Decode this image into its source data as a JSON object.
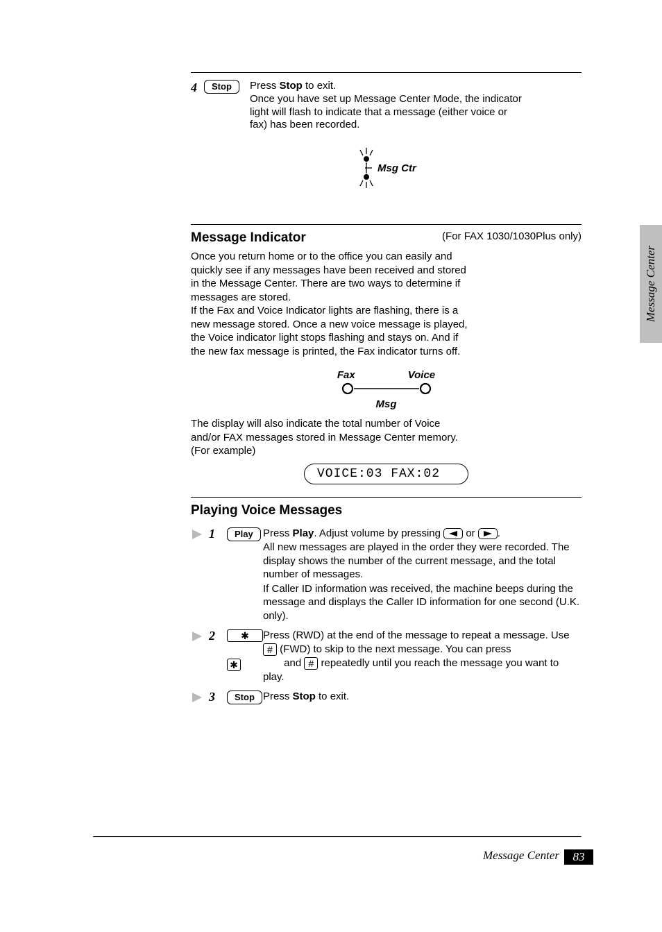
{
  "sidetab": {
    "text": "Message Center"
  },
  "b1": {
    "step_num": "4",
    "key_label": "Stop",
    "text_lines": [
      "Press Stop to exit.",
      "Once you have set up Message Center Mode, the indicator",
      "light will flash to indicate that a message (either voice or",
      "fax) has been recorded."
    ],
    "indicator_label": "Msg Ctr"
  },
  "b2": {
    "heading": "Message Indicator",
    "model": "(For FAX 1030/1030Plus only)",
    "body_lines": [
      "Once you return home or to the office you can easily and",
      "quickly see if any messages have been received and stored",
      "in the Message Center. There are two ways to determine if",
      "messages are stored.",
      "If the Fax and Voice Indicator lights are flashing, there is a",
      "new message stored. Once a new voice message is played,",
      "the Voice indicator light stops flashing and stays on. And if",
      "the new fax message is printed, the Fax indicator turns off."
    ],
    "ind2": {
      "label_fax": "Fax",
      "label_voice": "Voice",
      "sub": "Msg"
    },
    "example_lines": [
      "The display will also indicate the total number of Voice",
      "and/or FAX messages stored in Message Center memory.",
      "(For example)"
    ],
    "lcd": "VOICE:03 FAX:02"
  },
  "b3": {
    "heading": "Playing Voice Messages",
    "steps": [
      {
        "num": "1",
        "key_label": "Play",
        "para1_before": "Press ",
        "para1_bold": "Play",
        "para1_after": ". Adjust volume by pressing",
        "para1_or": " or ",
        "para1_tail": ".",
        "para2": "All new messages are played in the order they were recorded. The display shows the number of the current message, and the total number of messages.",
        "para3": "If Caller ID information was received, the machine beeps during the message and displays the Caller ID information for one second (U.K. only)."
      },
      {
        "num": "2",
        "key1": "✱",
        "key2": "#",
        "para1_before": "Press ",
        "para1_mid": " (RWD) at the end of the message to repeat a message. Use ",
        "para1_after": " (FWD) to skip to the next message. You can press ",
        "para1_and": " and ",
        "para1_tail": " repeatedly until you reach the message you want to play."
      },
      {
        "num": "3",
        "key_label": "Stop",
        "text_before": "Press ",
        "text_bold": "Stop",
        "text_after": " to exit."
      }
    ]
  },
  "footer": {
    "chapter": "Message Center",
    "pagenum": "83"
  },
  "icons": {
    "star": "✱",
    "hash": "#"
  }
}
